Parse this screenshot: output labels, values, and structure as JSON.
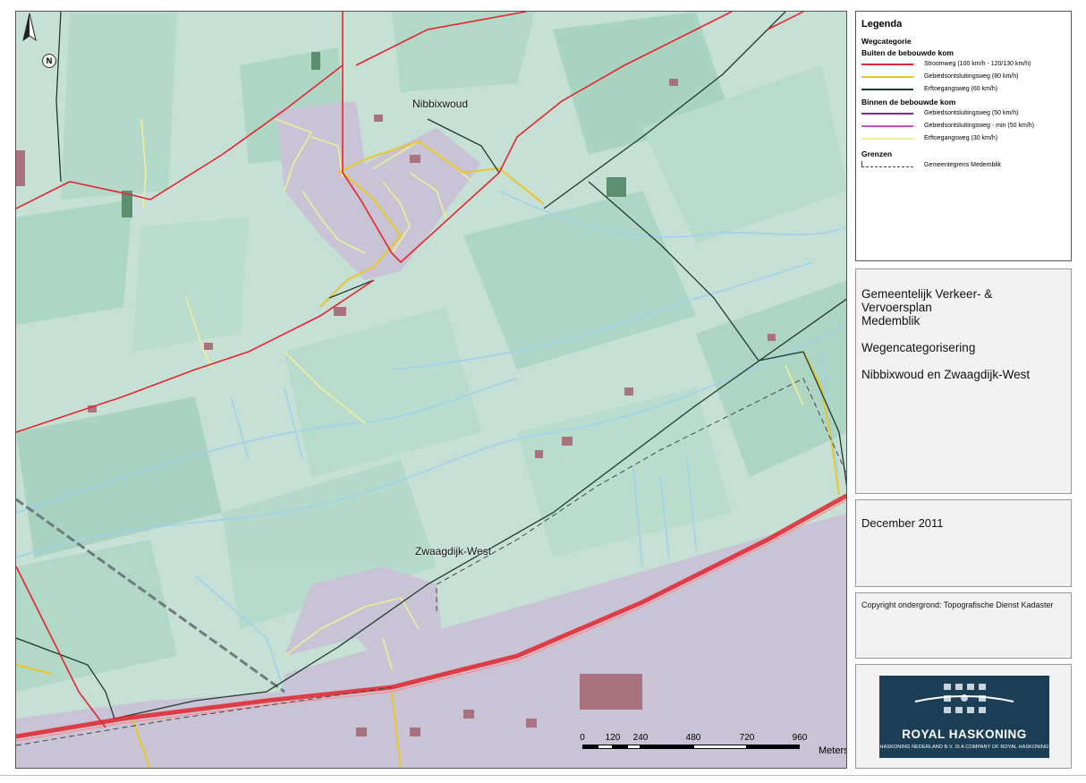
{
  "map": {
    "place_labels": {
      "nibbixwoud": "Nibbixwoud",
      "zwaagdijk_west": "Zwaagdijk-West"
    },
    "north_symbol": "N",
    "scale": {
      "ticks": [
        "0",
        "120",
        "240",
        "480",
        "720",
        "960"
      ],
      "units": "Meters"
    },
    "colors": {
      "stroomweg": "#e3262d",
      "gebiedsontsluitingsweg_80": "#e7c72a",
      "erftoegangsweg_60": "#1f3a2a",
      "gebiedsontsluitingsweg_50": "#7a2f8e",
      "gebiedsontsluitingsweg_min_50": "#d14bc9",
      "erftoegangsweg_30": "#f0ee9a",
      "gemeentegrens": "#444444",
      "water": "#9fd0f0",
      "built_up": "#c9bfd6",
      "buildings": "#a8727e"
    }
  },
  "legend": {
    "title": "Legenda",
    "category_heading": "Wegcategorie",
    "group_outside": "Buiten de bebouwde kom",
    "group_inside": "Binnen de bebouwde kom",
    "group_borders": "Grenzen",
    "items_outside": [
      {
        "label": "Stroomweg (100 km/h - 120/130 km/h)",
        "color": "#e3262d"
      },
      {
        "label": "Gebiedsontsluitingsweg (80 km/h)",
        "color": "#e7c72a"
      },
      {
        "label": "Erftoegangsweg (60 km/h)",
        "color": "#1f3a2a"
      }
    ],
    "items_inside": [
      {
        "label": "Gebiedsontsluitingsweg (50 km/h)",
        "color": "#7a2f8e"
      },
      {
        "label": "Gebiedsontsluitingsweg - min (50 km/h)",
        "color": "#d14bc9"
      },
      {
        "label": "Erftoegangsweg (30 km/h)",
        "color": "#f0ee9a"
      }
    ],
    "border_item": "Gemeentegrens Medemblik"
  },
  "title_block": {
    "line1": "Gemeentelijk Verkeer- & Vervoersplan",
    "line2": "Medemblik",
    "subtitle": "Wegencategorisering",
    "area": "Nibbixwoud en Zwaagdijk-West"
  },
  "date": "December 2011",
  "copyright": "Copyright ondergrond: Topografische Dienst Kadaster",
  "logo": {
    "name": "ROYAL HASKONING",
    "sub": "HASKONING NEDERLAND B.V. IS A COMPANY OF ROYAL HASKONING"
  }
}
